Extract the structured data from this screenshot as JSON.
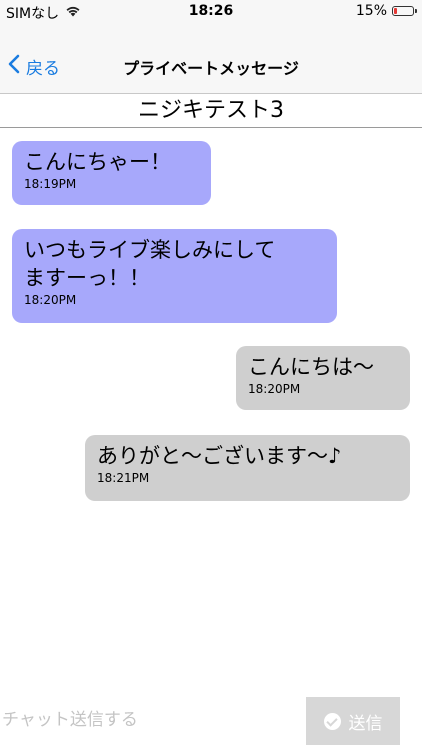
{
  "status_bar": {
    "carrier": "SIMなし",
    "time": "18:26",
    "battery_text": "15%",
    "battery_level": 0.15,
    "battery_color": "#e53935",
    "icons": [
      "wifi-icon",
      "battery-icon"
    ]
  },
  "nav": {
    "back_label": "戻る",
    "title": "プライベートメッセージ",
    "accent_color": "#1a7ce0"
  },
  "conversation": {
    "name": "ニジキテスト3"
  },
  "messages": [
    {
      "direction": "incoming",
      "text": "こんにちゃー！",
      "time": "18:19PM"
    },
    {
      "direction": "incoming",
      "text": "いつもライブ楽しみにして\nますーっ！！",
      "time": "18:20PM"
    },
    {
      "direction": "outgoing",
      "text": "こんにちは〜",
      "time": "18:20PM"
    },
    {
      "direction": "outgoing",
      "text": "ありがと〜ございます〜♪",
      "time": "18:21PM"
    }
  ],
  "colors": {
    "incoming_bubble": "#a7a8fb",
    "outgoing_bubble": "#cfcfcf",
    "send_button_bg": "#d7d7d7"
  },
  "composer": {
    "placeholder": "チャット送信する",
    "value": "",
    "send_label": "送信",
    "send_icon": "check-circle-icon"
  }
}
